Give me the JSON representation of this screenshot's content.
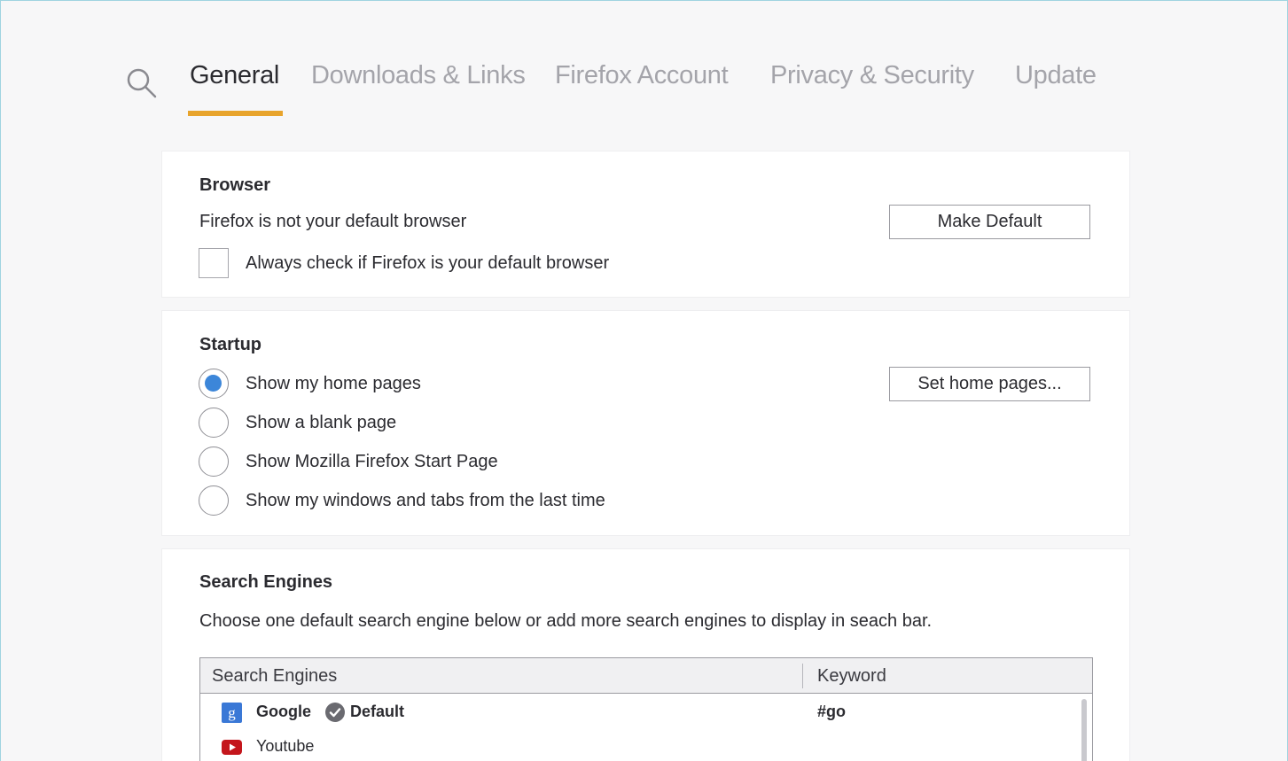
{
  "tabs": [
    {
      "label": "General",
      "active": true
    },
    {
      "label": "Downloads & Links",
      "active": false
    },
    {
      "label": "Firefox Account",
      "active": false
    },
    {
      "label": "Privacy & Security",
      "active": false
    },
    {
      "label": "Update",
      "active": false
    }
  ],
  "icons": {
    "search": "search-icon",
    "google": "google-icon",
    "youtube": "youtube-icon",
    "default_check": "check-circle-icon"
  },
  "colors": {
    "accent": "#e8a42c",
    "radio_selected": "#3c86d9",
    "google": "#3a78d6",
    "youtube": "#c4161c"
  },
  "browser": {
    "title": "Browser",
    "status_text": "Firefox is not your default browser",
    "make_default_label": "Make Default",
    "always_check_label": "Always check if Firefox is your default browser",
    "always_check_checked": false
  },
  "startup": {
    "title": "Startup",
    "set_home_label": "Set home pages...",
    "options": [
      {
        "label": "Show my home pages",
        "selected": true
      },
      {
        "label": "Show a blank page",
        "selected": false
      },
      {
        "label": "Show Mozilla Firefox Start Page",
        "selected": false
      },
      {
        "label": "Show my windows and tabs from the last time",
        "selected": false
      }
    ]
  },
  "search_engines": {
    "title": "Search Engines",
    "description": "Choose one default search engine below or add more search engines to display in seach bar.",
    "columns": [
      "Search Engines",
      "Keyword"
    ],
    "rows": [
      {
        "name": "Google",
        "default_label": "Default",
        "keyword": "#go"
      },
      {
        "name": "Youtube",
        "default_label": "",
        "keyword": ""
      }
    ]
  }
}
